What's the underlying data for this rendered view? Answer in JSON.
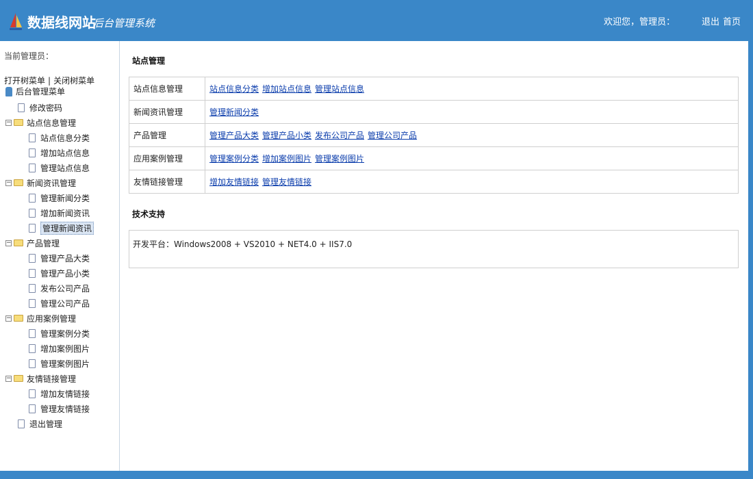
{
  "header": {
    "title": "数据线网站",
    "subtitle": "后台管理系统",
    "welcome": "欢迎您，管理员：",
    "logout": "退出",
    "home": "首页",
    "brand_color": "#3a87c8"
  },
  "sidebar": {
    "current_admin": "当前管理员：",
    "open_tree": "打开树菜单",
    "close_tree": "关闭树菜单",
    "root": "后台管理菜单",
    "items": [
      {
        "label": "修改密码",
        "level": 1,
        "type": "doc"
      },
      {
        "label": "站点信息管理",
        "level": 1,
        "type": "folder"
      },
      {
        "label": "站点信息分类",
        "level": 2,
        "type": "doc"
      },
      {
        "label": "增加站点信息",
        "level": 2,
        "type": "doc"
      },
      {
        "label": "管理站点信息",
        "level": 2,
        "type": "doc"
      },
      {
        "label": "新闻资讯管理",
        "level": 1,
        "type": "folder"
      },
      {
        "label": "管理新闻分类",
        "level": 2,
        "type": "doc"
      },
      {
        "label": "增加新闻资讯",
        "level": 2,
        "type": "doc"
      },
      {
        "label": "管理新闻资讯",
        "level": 2,
        "type": "doc",
        "selected": true
      },
      {
        "label": "产品管理",
        "level": 1,
        "type": "folder"
      },
      {
        "label": "管理产品大类",
        "level": 2,
        "type": "doc"
      },
      {
        "label": "管理产品小类",
        "level": 2,
        "type": "doc"
      },
      {
        "label": "发布公司产品",
        "level": 2,
        "type": "doc"
      },
      {
        "label": "管理公司产品",
        "level": 2,
        "type": "doc"
      },
      {
        "label": "应用案例管理",
        "level": 1,
        "type": "folder"
      },
      {
        "label": "管理案例分类",
        "level": 2,
        "type": "doc"
      },
      {
        "label": "增加案例图片",
        "level": 2,
        "type": "doc"
      },
      {
        "label": "管理案例图片",
        "level": 2,
        "type": "doc"
      },
      {
        "label": "友情链接管理",
        "level": 1,
        "type": "folder"
      },
      {
        "label": "增加友情链接",
        "level": 2,
        "type": "doc"
      },
      {
        "label": "管理友情链接",
        "level": 2,
        "type": "doc"
      },
      {
        "label": "退出管理",
        "level": 1,
        "type": "doc"
      }
    ]
  },
  "main": {
    "section_site": "站点管理",
    "rows": [
      {
        "label": "站点信息管理",
        "links": [
          "站点信息分类",
          "增加站点信息",
          "管理站点信息"
        ]
      },
      {
        "label": "新闻资讯管理",
        "links": [
          "管理新闻分类"
        ]
      },
      {
        "label": "产品管理",
        "links": [
          "管理产品大类",
          "管理产品小类",
          "发布公司产品",
          "管理公司产品"
        ]
      },
      {
        "label": "应用案例管理",
        "links": [
          "管理案例分类",
          "增加案例图片",
          "管理案例图片"
        ]
      },
      {
        "label": "友情链接管理",
        "links": [
          "增加友情链接",
          "管理友情链接"
        ]
      }
    ],
    "section_tech": "技术支持",
    "tech_text": "开发平台：Windows2008 + VS2010 + NET4.0 + IIS7.0"
  }
}
